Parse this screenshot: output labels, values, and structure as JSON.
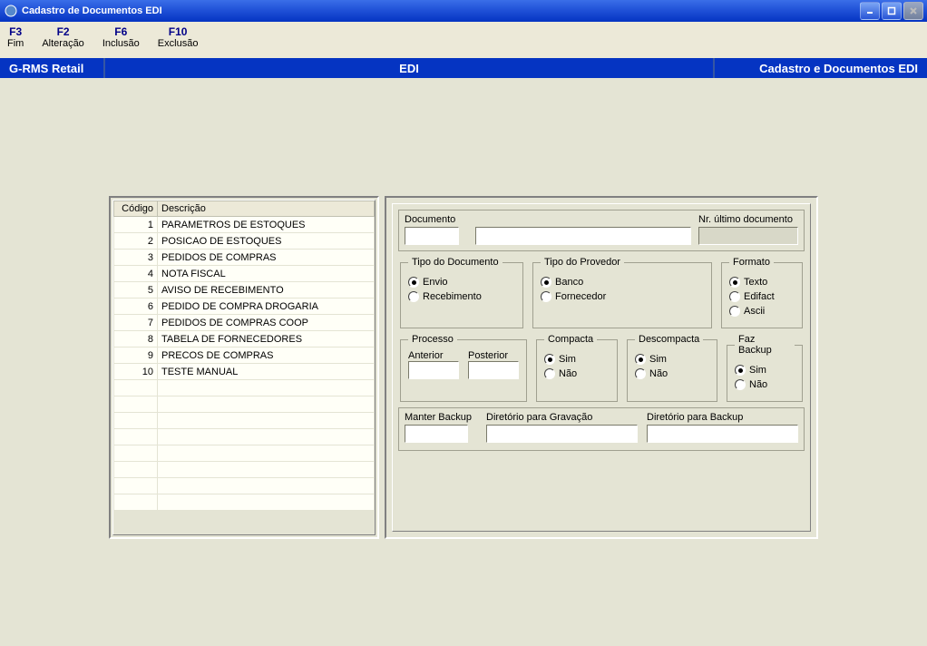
{
  "window": {
    "title": "Cadastro de Documentos EDI"
  },
  "menu": [
    {
      "key": "F3",
      "label": "Fim"
    },
    {
      "key": "F2",
      "label": "Alteração"
    },
    {
      "key": "F6",
      "label": "Inclusão"
    },
    {
      "key": "F10",
      "label": "Exclusão"
    }
  ],
  "strip": {
    "left": "G-RMS Retail",
    "center": "EDI",
    "right": "Cadastro e Documentos EDI"
  },
  "table": {
    "headers": {
      "codigo": "Código",
      "descricao": "Descrição"
    },
    "rows": [
      {
        "codigo": "1",
        "descricao": "PARAMETROS DE ESTOQUES"
      },
      {
        "codigo": "2",
        "descricao": "POSICAO DE ESTOQUES"
      },
      {
        "codigo": "3",
        "descricao": "PEDIDOS DE COMPRAS"
      },
      {
        "codigo": "4",
        "descricao": "NOTA FISCAL"
      },
      {
        "codigo": "5",
        "descricao": "AVISO DE RECEBIMENTO"
      },
      {
        "codigo": "6",
        "descricao": "PEDIDO DE COMPRA DROGARIA"
      },
      {
        "codigo": "7",
        "descricao": "PEDIDOS DE COMPRAS COOP"
      },
      {
        "codigo": "8",
        "descricao": "TABELA DE FORNECEDORES"
      },
      {
        "codigo": "9",
        "descricao": "PRECOS DE COMPRAS"
      },
      {
        "codigo": "10",
        "descricao": "TESTE MANUAL"
      }
    ]
  },
  "form": {
    "documento_label": "Documento",
    "nr_ultimo_label": "Nr. último documento",
    "documento_code": "",
    "documento_desc": "",
    "nr_ultimo": "",
    "tipo_documento": {
      "legend": "Tipo do Documento",
      "envio": "Envio",
      "recebimento": "Recebimento",
      "selected": "envio"
    },
    "tipo_provedor": {
      "legend": "Tipo do Provedor",
      "banco": "Banco",
      "fornecedor": "Fornecedor",
      "selected": "banco"
    },
    "formato": {
      "legend": "Formato",
      "texto": "Texto",
      "edifact": "Edifact",
      "ascii": "Ascii",
      "selected": "texto"
    },
    "processo": {
      "legend": "Processo",
      "anterior_label": "Anterior",
      "posterior_label": "Posterior",
      "anterior": "",
      "posterior": ""
    },
    "compacta": {
      "legend": "Compacta",
      "sim": "Sim",
      "nao": "Não",
      "selected": "sim"
    },
    "descompacta": {
      "legend": "Descompacta",
      "sim": "Sim",
      "nao": "Não",
      "selected": "sim"
    },
    "faz_backup": {
      "legend": "Faz Backup",
      "sim": "Sim",
      "nao": "Não",
      "selected": "sim"
    },
    "bottom": {
      "manter_backup_label": "Manter Backup",
      "dir_gravacao_label": "Diretório para Gravação",
      "dir_backup_label": "Diretório para Backup",
      "manter_backup": "",
      "dir_gravacao": "",
      "dir_backup": ""
    }
  }
}
